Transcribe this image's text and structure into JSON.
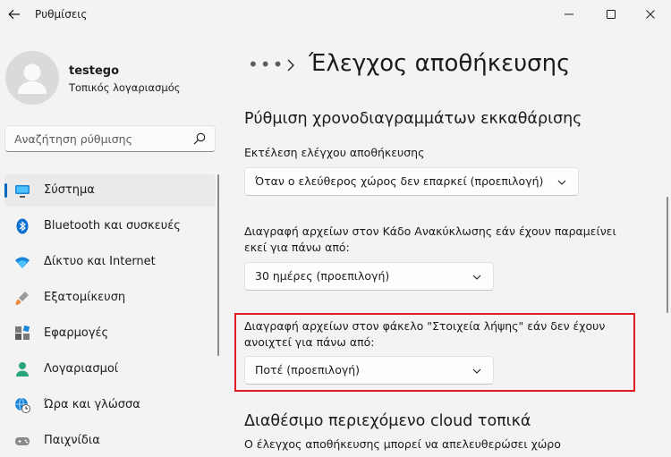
{
  "window": {
    "title": "Ρυθμίσεις"
  },
  "profile": {
    "name": "testego",
    "account_type": "Τοπικός λογαριασμός"
  },
  "search": {
    "placeholder": "Αναζήτηση ρύθμισης"
  },
  "nav": {
    "items": [
      {
        "label": "Σύστημα",
        "icon": "monitor-icon",
        "active": true
      },
      {
        "label": "Bluetooth και συσκευές",
        "icon": "bluetooth-icon"
      },
      {
        "label": "Δίκτυο και Internet",
        "icon": "wifi-icon"
      },
      {
        "label": "Εξατομίκευση",
        "icon": "brush-icon"
      },
      {
        "label": "Εφαρμογές",
        "icon": "apps-icon"
      },
      {
        "label": "Λογαριασμοί",
        "icon": "person-icon"
      },
      {
        "label": "Ώρα και γλώσσα",
        "icon": "globe-clock-icon"
      },
      {
        "label": "Παιχνίδια",
        "icon": "gamepad-icon"
      }
    ]
  },
  "breadcrumb": {
    "more": "•••",
    "title": "Έλεγχος αποθήκευσης"
  },
  "cleanup_section": {
    "heading": "Ρύθμιση χρονοδιαγραμμάτων εκκαθάρισης",
    "run_label": "Εκτέλεση ελέγχου αποθήκευσης",
    "run_value": "Όταν ο ελεύθερος χώρος δεν επαρκεί (προεπιλογή)",
    "recycle_label_line1": "Διαγραφή αρχείων στον Κάδο Ανακύκλωσης εάν έχουν παραμείνει",
    "recycle_label_line2": "εκεί για πάνω από:",
    "recycle_value": "30 ημέρες (προεπιλογή)",
    "downloads_label_line1": "Διαγραφή αρχείων στον φάκελο \"Στοιχεία λήψης\" εάν δεν έχουν",
    "downloads_label_line2": "ανοιχτεί για πάνω από:",
    "downloads_value": "Ποτέ (προεπιλογή)"
  },
  "cloud_section": {
    "heading": "Διαθέσιμο περιεχόμενο cloud τοπικά",
    "text": "Ο έλεγχος αποθήκευσης μπορεί να απελευθερώσει χώρο"
  },
  "colors": {
    "accent": "#0067c0",
    "highlight": "#e01b24"
  }
}
